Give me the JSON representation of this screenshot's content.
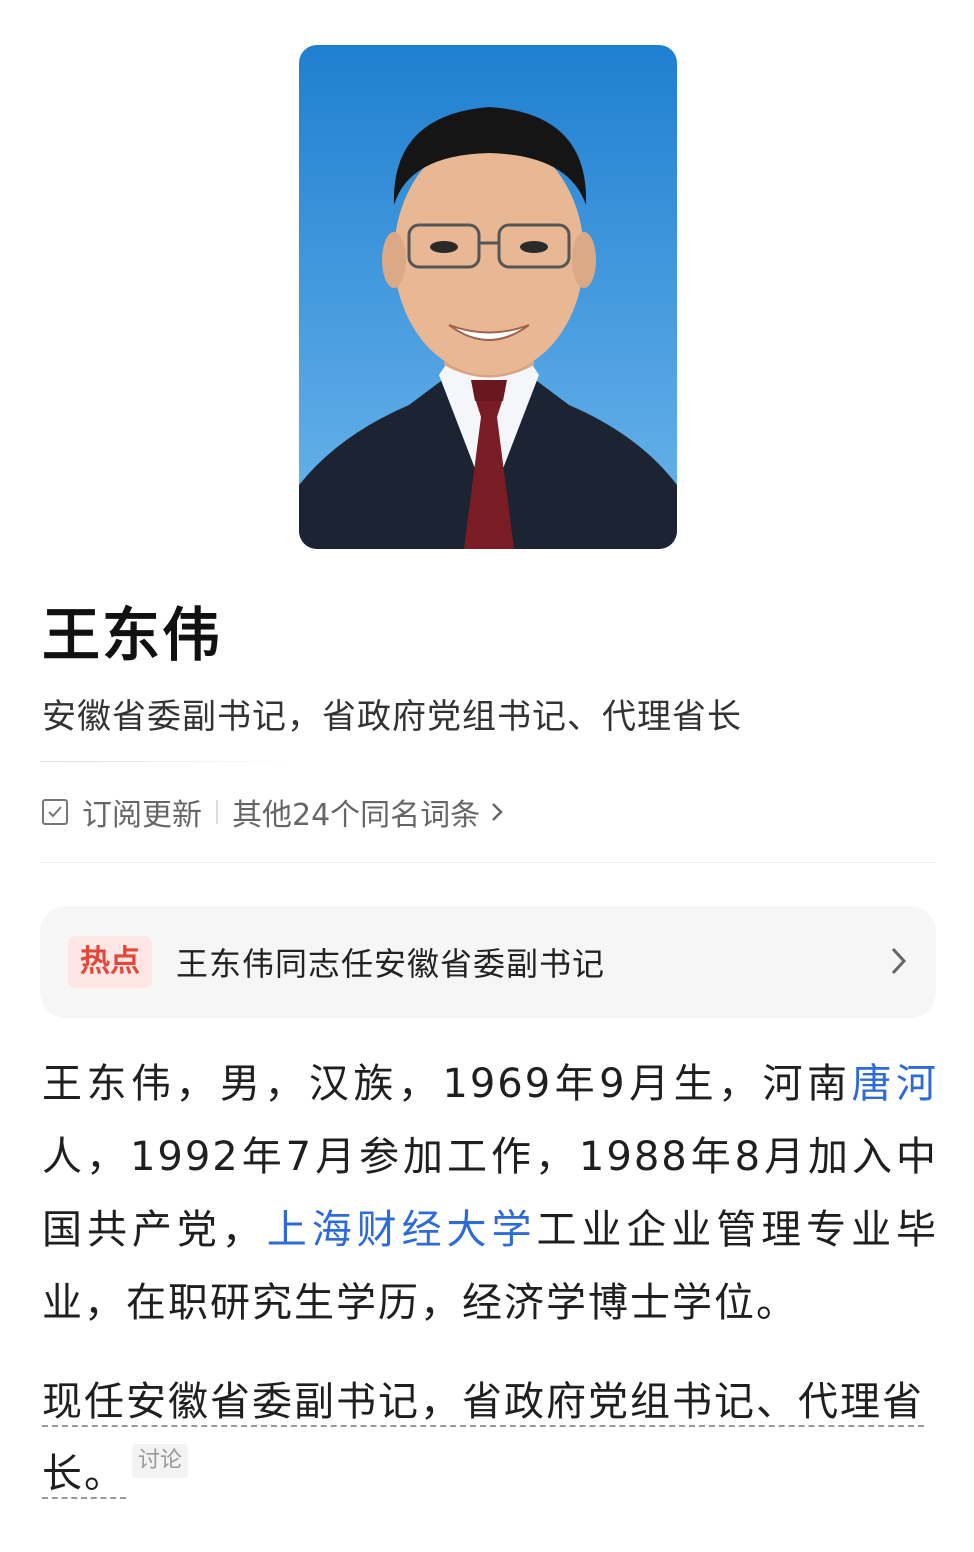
{
  "profile": {
    "name": "王东伟",
    "subtitle": "安徽省委副书记，省政府党组书记、代理省长"
  },
  "actions": {
    "subscribe_label": "订阅更新",
    "same_name_label": "其他24个同名词条"
  },
  "hot": {
    "badge": "热点",
    "text": "王东伟同志任安徽省委副书记"
  },
  "intro": {
    "p1": "王东伟，男，汉族，1969年9月生，河南",
    "link1": "唐河",
    "p2": "人，1992年7月参加工作，1988年8月加入中国共产党，",
    "link2": "上海财经大学",
    "p3": "工业企业管理专业毕业，在职研究生学历，经济学博士学位。"
  },
  "current": {
    "text": "现任安徽省委副书记，省政府党组书记、代理省长。",
    "discuss_tag": "讨论"
  },
  "colors": {
    "link": "#2e6bd6",
    "hot_badge_bg": "#fde6e4",
    "hot_badge_text": "#e1473a",
    "portrait_bg": "#2f8fd8"
  }
}
